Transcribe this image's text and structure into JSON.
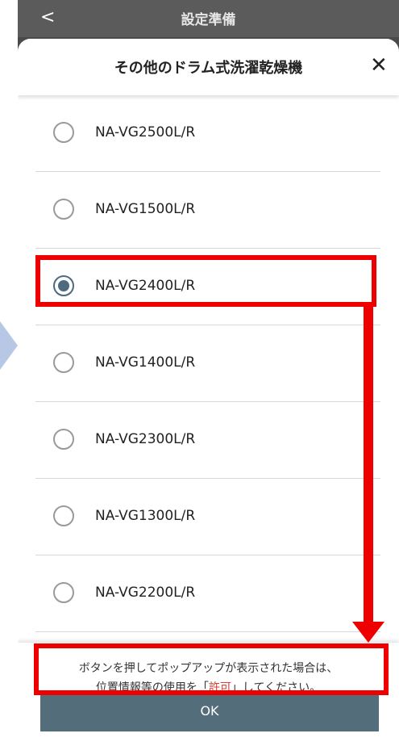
{
  "topbar": {
    "back_glyph": "<",
    "title": "設定準備"
  },
  "sheet": {
    "title": "その他のドラム式洗濯乾燥機",
    "close_glyph": "✕"
  },
  "options": [
    {
      "label": "NA-VG2500L/R",
      "selected": false
    },
    {
      "label": "NA-VG1500L/R",
      "selected": false
    },
    {
      "label": "NA-VG2400L/R",
      "selected": true
    },
    {
      "label": "NA-VG1400L/R",
      "selected": false
    },
    {
      "label": "NA-VG2300L/R",
      "selected": false
    },
    {
      "label": "NA-VG1300L/R",
      "selected": false
    },
    {
      "label": "NA-VG2200L/R",
      "selected": false
    }
  ],
  "footer": {
    "notice_line1": "ボタンを押してポップアップが表示された場合は、",
    "notice_line2_pre": "位置情報等の使用を「",
    "notice_line2_red": "許可",
    "notice_line2_post": "」してください。",
    "ok_label": "OK"
  },
  "colors": {
    "accent": "#546d7a",
    "highlight": "#ee0000",
    "allow_text": "#e13b2f"
  }
}
